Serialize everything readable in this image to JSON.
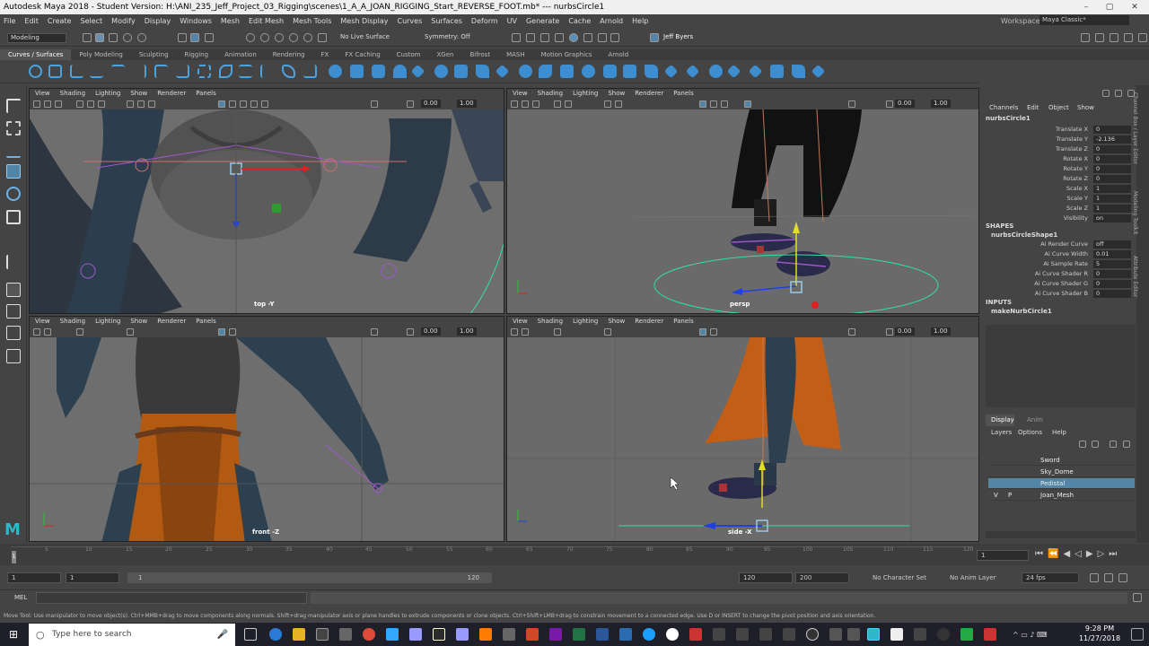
{
  "window": {
    "title": "Autodesk Maya 2018 - Student Version: H:\\ANI_235_Jeff_Project_03_Rigging\\scenes\\1_A_A_JOAN_RIGGING_Start_REVERSE_FOOT.mb*  ---  nurbsCircle1",
    "workspace_label": "Workspace :",
    "workspace_value": "Maya Classic*"
  },
  "menu": [
    "File",
    "Edit",
    "Create",
    "Select",
    "Modify",
    "Display",
    "Windows",
    "Mesh",
    "Edit Mesh",
    "Mesh Tools",
    "Mesh Display",
    "Curves",
    "Surfaces",
    "Deform",
    "UV",
    "Generate",
    "Cache",
    "Arnold",
    "Help"
  ],
  "status": {
    "mode": "Modeling",
    "live_surface": "No Live Surface",
    "symmetry": "Symmetry: Off",
    "user": "Jeff Byers"
  },
  "shelf_tabs": [
    "Curves / Surfaces",
    "Poly Modeling",
    "Sculpting",
    "Rigging",
    "Animation",
    "Rendering",
    "FX",
    "FX Caching",
    "Custom",
    "XGen",
    "Bifrost",
    "MASH",
    "Motion Graphics",
    "Arnold"
  ],
  "viewport_menu": [
    "View",
    "Shading",
    "Lighting",
    "Show",
    "Renderer",
    "Panels"
  ],
  "viewports": [
    {
      "label": "top -Y",
      "val1": "0.00",
      "val2": "1.00"
    },
    {
      "label": "persp",
      "val1": "0.00",
      "val2": "1.00"
    },
    {
      "label": "front -Z",
      "val1": "0.00",
      "val2": "1.00"
    },
    {
      "label": "side -X",
      "val1": "0.00",
      "val2": "1.00"
    }
  ],
  "channel_box": {
    "menu": [
      "Channels",
      "Edit",
      "Object",
      "Show"
    ],
    "object": "nurbsCircle1",
    "attrs": [
      {
        "n": "Translate X",
        "v": "0"
      },
      {
        "n": "Translate Y",
        "v": "-2.136"
      },
      {
        "n": "Translate Z",
        "v": "0"
      },
      {
        "n": "Rotate X",
        "v": "0"
      },
      {
        "n": "Rotate Y",
        "v": "0"
      },
      {
        "n": "Rotate Z",
        "v": "0"
      },
      {
        "n": "Scale X",
        "v": "1"
      },
      {
        "n": "Scale Y",
        "v": "1"
      },
      {
        "n": "Scale Z",
        "v": "1"
      },
      {
        "n": "Visibility",
        "v": "on"
      }
    ],
    "shapes_header": "SHAPES",
    "shape_name": "nurbsCircleShape1",
    "shape_attrs": [
      {
        "n": "Ai Render Curve",
        "v": "off"
      },
      {
        "n": "Ai Curve Width",
        "v": "0.01"
      },
      {
        "n": "Ai Sample Rate",
        "v": "5"
      },
      {
        "n": "Ai Curve Shader R",
        "v": "0"
      },
      {
        "n": "Ai Curve Shader G",
        "v": "0"
      },
      {
        "n": "Ai Curve Shader B",
        "v": "0"
      }
    ],
    "inputs_header": "INPUTS",
    "input_name": "makeNurbCircle1"
  },
  "side_tabs": [
    "Channel Box / Layer Editor",
    "Modeling Toolkit",
    "Attribute Editor"
  ],
  "layers": {
    "tabs": [
      "Display",
      "Anim"
    ],
    "menu": [
      "Layers",
      "Options",
      "Help"
    ],
    "items": [
      {
        "name": "Sword",
        "v": "",
        "p": ""
      },
      {
        "name": "Sky_Dome",
        "v": "",
        "p": ""
      },
      {
        "name": "Pedistal",
        "v": "",
        "p": ""
      },
      {
        "name": "Joan_Mesh",
        "v": "V",
        "p": "P"
      }
    ]
  },
  "timeline": {
    "ticks": [
      "5",
      "10",
      "15",
      "20",
      "25",
      "30",
      "35",
      "40",
      "45",
      "50",
      "55",
      "60",
      "65",
      "70",
      "75",
      "80",
      "85",
      "90",
      "95",
      "100",
      "105",
      "110",
      "115",
      "120"
    ],
    "current": "1"
  },
  "range": {
    "start": "1",
    "start2": "1",
    "slider_start": "1",
    "slider_end": "120",
    "end": "120",
    "end2": "200",
    "char_set": "No Character Set",
    "anim_layer": "No Anim Layer",
    "fps": "24 fps"
  },
  "mel": "MEL",
  "help": "Move Tool: Use manipulator to move object(s). Ctrl+MMB+drag to move components along normals. Shift+drag manipulator axis or plane handles to extrude components or clone objects. Ctrl+Shift+LMB+drag to constrain movement to a connected edge. Use D or INSERT to change the pivot position and axis orientation.",
  "taskbar": {
    "search_placeholder": "Type here to search",
    "time": "9:28 PM",
    "date": "11/27/2018"
  }
}
